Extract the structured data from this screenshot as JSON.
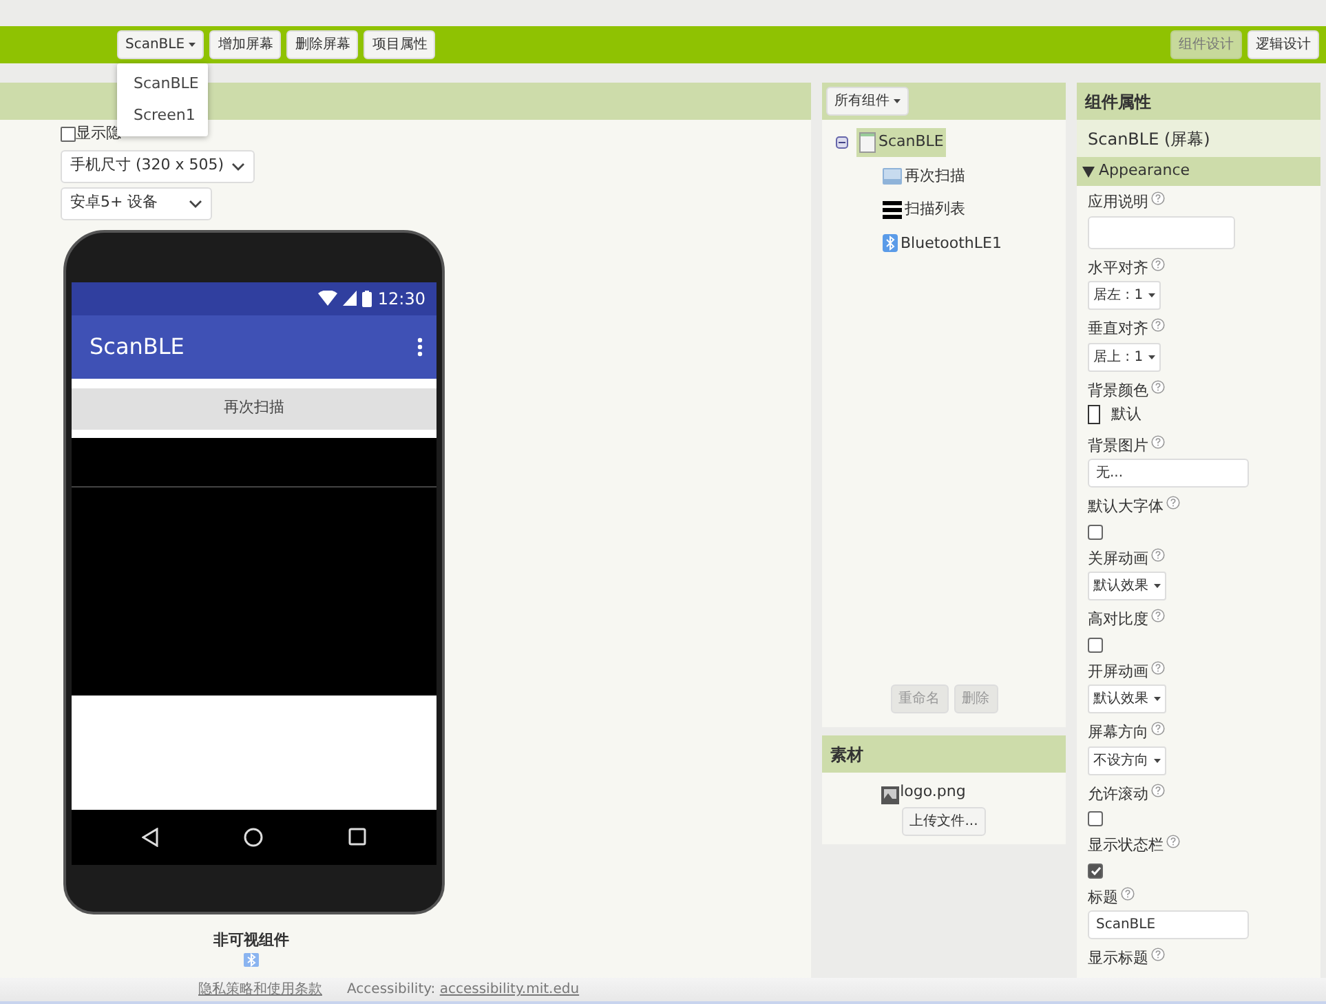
{
  "toolbar": {
    "screen_button": "ScanBLE",
    "buttons": [
      "增加屏幕",
      "删除屏幕",
      "项目属性"
    ],
    "screen_menu": [
      "ScanBLE",
      "Screen1"
    ],
    "modes": [
      {
        "label": "组件设计",
        "selected": true
      },
      {
        "label": "逻辑设计",
        "selected": false
      }
    ]
  },
  "viewer": {
    "hidden_toggle": {
      "label": "显示隐",
      "checked": false
    },
    "size_select": "手机尺寸 (320 x 505)",
    "device_select": "安卓5+ 设备",
    "phone": {
      "time": "12:30",
      "title": "ScanBLE",
      "button": "再次扫描"
    },
    "nonvisible_title": "非可视组件"
  },
  "components": {
    "filter": "所有组件",
    "tree": [
      {
        "label": "ScanBLE",
        "kind": "screen",
        "selected": true,
        "expanded": true,
        "children": [
          {
            "label": "再次扫描",
            "kind": "button",
            "selected": false
          },
          {
            "label": "扫描列表",
            "kind": "list",
            "selected": false
          },
          {
            "label": "BluetoothLE1",
            "kind": "bluetooth",
            "selected": false
          }
        ]
      }
    ],
    "buttons": [
      {
        "label": "重命名",
        "disabled": true
      },
      {
        "label": "删除",
        "disabled": true
      }
    ]
  },
  "media": {
    "title": "素材",
    "files": [
      "logo.png"
    ],
    "upload": "上传文件..."
  },
  "properties": {
    "title": "组件属性",
    "component": "ScanBLE (屏幕)",
    "section": "Appearance",
    "expanded": true,
    "items": [
      {
        "label": "应用说明",
        "kind": "textarea",
        "value": ""
      },
      {
        "label": "水平对齐",
        "kind": "select",
        "value": "居左 : 1"
      },
      {
        "label": "垂直对齐",
        "kind": "select",
        "value": "居上 : 1"
      },
      {
        "label": "背景颜色",
        "kind": "color",
        "value": "默认"
      },
      {
        "label": "背景图片",
        "kind": "text",
        "value": "无..."
      },
      {
        "label": "默认大字体",
        "kind": "checkbox",
        "checked": false
      },
      {
        "label": "关屏动画",
        "kind": "select",
        "value": "默认效果"
      },
      {
        "label": "高对比度",
        "kind": "checkbox",
        "checked": false
      },
      {
        "label": "开屏动画",
        "kind": "select",
        "value": "默认效果"
      },
      {
        "label": "屏幕方向",
        "kind": "select",
        "value": "不设方向"
      },
      {
        "label": "允许滚动",
        "kind": "checkbox",
        "checked": false
      },
      {
        "label": "显示状态栏",
        "kind": "checkbox",
        "checked": true
      },
      {
        "label": "标题",
        "kind": "text",
        "value": "ScanBLE"
      },
      {
        "label": "显示标题",
        "kind": "cut"
      }
    ]
  },
  "footer": {
    "privacy": "隐私策略和使用条款",
    "accessibility_label": "Accessibility:",
    "accessibility_link": "accessibility.mit.edu"
  }
}
